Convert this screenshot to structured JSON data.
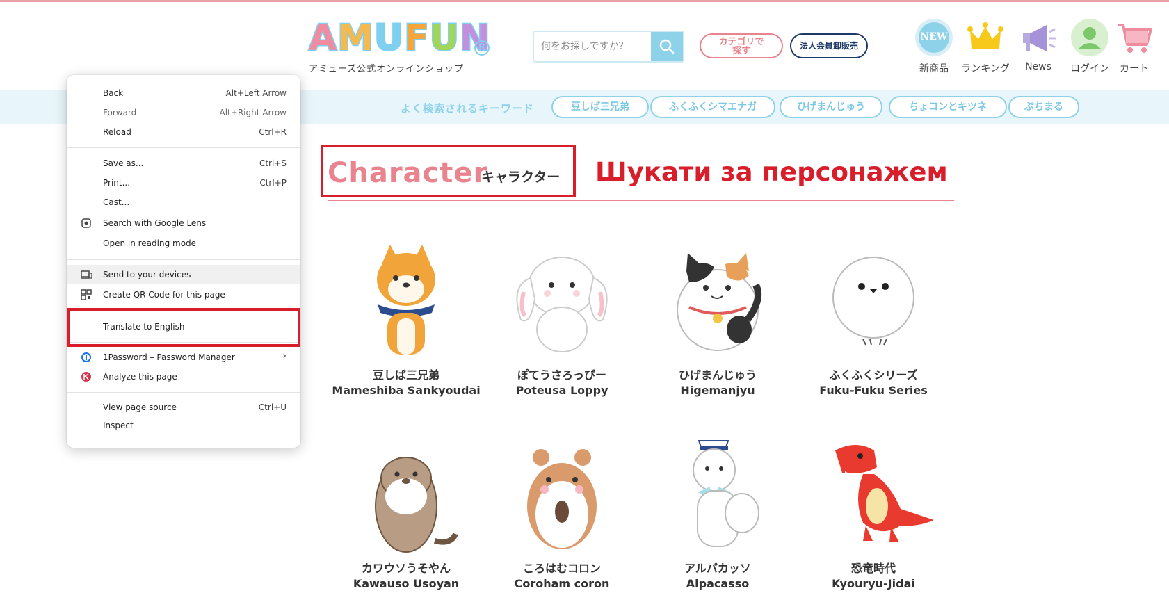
{
  "brand": {
    "logo_letters": [
      "A",
      "M",
      "U",
      "F",
      "U",
      "N"
    ],
    "logo_colors": [
      "#f08ca0",
      "#f6b94d",
      "#7fd0f0",
      "#f6a53b",
      "#a2d55a",
      "#c48fdc"
    ],
    "registered_mark": "R",
    "subtitle": "アミューズ公式オンラインショップ"
  },
  "search": {
    "placeholder": "何をお探しですか？",
    "button_icon": "search-icon"
  },
  "header_buttons": {
    "category_line1": "カテゴリで",
    "category_line2": "探す",
    "corporate": "法人会員卸販売"
  },
  "header_nav": [
    {
      "name": "new",
      "badge": "NEW",
      "label": "新商品",
      "icon": "new-badge-icon"
    },
    {
      "name": "ranking",
      "label": "ランキング",
      "icon": "crown-icon"
    },
    {
      "name": "news",
      "label": "News",
      "icon": "megaphone-icon"
    },
    {
      "name": "login",
      "label": "ログイン",
      "icon": "user-icon"
    },
    {
      "name": "cart",
      "label": "カート",
      "icon": "cart-icon"
    }
  ],
  "keywords": {
    "title": "よく検索されるキーワード",
    "items": [
      "豆しば三兄弟",
      "ふくふくシマエナガ",
      "ひげまんじゅう",
      "ちょコンとキツネ",
      "ぷちまる"
    ]
  },
  "section": {
    "title_en": "Character",
    "title_jp": "キャラクター",
    "annotation": "Шукати за персонажем"
  },
  "characters": [
    {
      "jp": "豆しば三兄弟",
      "en": "Mameshiba Sankyoudai",
      "icon": "shiba-dog-icon"
    },
    {
      "jp": "ぽてうさろっぴー",
      "en": "Poteusa Loppy",
      "icon": "bunny-icon"
    },
    {
      "jp": "ひげまんじゅう",
      "en": "Higemanjyu",
      "icon": "cat-icon"
    },
    {
      "jp": "ふくふくシリーズ",
      "en": "Fuku-Fuku Series",
      "icon": "bird-icon"
    },
    {
      "jp": "カワウソうそやん",
      "en": "Kawauso Usoyan",
      "icon": "otter-icon"
    },
    {
      "jp": "ころはむコロン",
      "en": "Coroham coron",
      "icon": "hamster-icon"
    },
    {
      "jp": "アルパカッソ",
      "en": "Alpacasso",
      "icon": "alpaca-icon"
    },
    {
      "jp": "恐竜時代",
      "en": "Kyouryu-Jidai",
      "icon": "dinosaur-icon"
    }
  ],
  "context_menu": {
    "items": [
      {
        "label": "Back",
        "shortcut": "Alt+Left Arrow"
      },
      {
        "label": "Forward",
        "shortcut": "Alt+Right Arrow"
      },
      {
        "label": "Reload",
        "shortcut": "Ctrl+R"
      },
      {
        "label": "Save as...",
        "shortcut": "Ctrl+S"
      },
      {
        "label": "Print...",
        "shortcut": "Ctrl+P"
      },
      {
        "label": "Cast...",
        "shortcut": ""
      },
      {
        "label": "Search with Google Lens",
        "shortcut": "",
        "icon": "google-lens-icon"
      },
      {
        "label": "Open in reading mode",
        "shortcut": ""
      },
      {
        "label": "Send to your devices",
        "shortcut": "",
        "icon": "devices-icon"
      },
      {
        "label": "Create QR Code for this page",
        "shortcut": "",
        "icon": "qr-code-icon"
      },
      {
        "label": "Translate to English",
        "shortcut": ""
      },
      {
        "label": "1Password – Password Manager",
        "shortcut": "",
        "icon": "1password-icon"
      },
      {
        "label": "Analyze this page",
        "shortcut": "",
        "icon": "analyze-extension-icon"
      },
      {
        "label": "View page source",
        "shortcut": "Ctrl+U"
      },
      {
        "label": "Inspect",
        "shortcut": ""
      }
    ]
  }
}
